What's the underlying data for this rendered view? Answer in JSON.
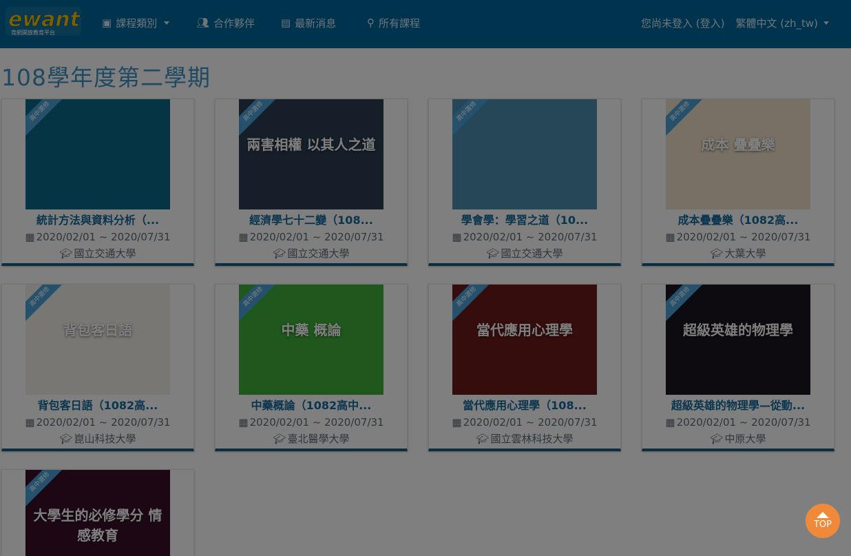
{
  "nav": {
    "logo_text": "ewant",
    "logo_sub": "育網開放教育平台",
    "items": [
      {
        "label": "課程類別",
        "icon": "archive-icon"
      },
      {
        "label": "合作夥伴",
        "icon": "users-icon"
      },
      {
        "label": "最新消息",
        "icon": "newspaper-icon"
      },
      {
        "label": "所有課程",
        "icon": "search-icon"
      }
    ],
    "login_text": "您尚未登入 (登入)",
    "language": "繁體中文 (zh_tw)"
  },
  "page": {
    "title": "108學年度第二學期"
  },
  "ribbon_label": "高中選修",
  "courses": [
    {
      "title": "統計方法與資料分析（...",
      "date": "2020/02/01 ~ 2020/07/31",
      "school": "國立交通大學",
      "theme": "#0a6b8a"
    },
    {
      "title": "經濟學七十二變（108...",
      "date": "2020/02/01 ~ 2020/07/31",
      "school": "國立交通大學",
      "theme": "#2b3d52",
      "overlay": "兩害相權 以其人之道"
    },
    {
      "title": "學會學：學習之道（10...",
      "date": "2020/02/01 ~ 2020/07/31",
      "school": "國立交通大學",
      "theme": "#4d8fb0"
    },
    {
      "title": "成本疊疊樂（1082高...",
      "date": "2020/02/01 ~ 2020/07/31",
      "school": "大葉大學",
      "theme": "#f0e0c8",
      "overlay": "成本 疊疊樂"
    },
    {
      "title": "背包客日語（1082高...",
      "date": "2020/02/01 ~ 2020/07/31",
      "school": "崑山科技大學",
      "theme": "#f2efe8",
      "overlay": "背包客日語"
    },
    {
      "title": "中藥概論（1082高中...",
      "date": "2020/02/01 ~ 2020/07/31",
      "school": "臺北醫學大學",
      "theme": "#3fae3a",
      "overlay": "中藥 概論"
    },
    {
      "title": "當代應用心理學（108...",
      "date": "2020/02/01 ~ 2020/07/31",
      "school": "國立雲林科技大學",
      "theme": "#6b1a1a",
      "overlay": "當代應用心理學"
    },
    {
      "title": "超級英雄的物理學—從動...",
      "date": "2020/02/01 ~ 2020/07/31",
      "school": "中原大學",
      "theme": "#1a1620",
      "overlay": "超級英雄的物理學"
    },
    {
      "title": "",
      "date": "",
      "school": "",
      "theme": "#3a0f2a",
      "overlay": "大學生的必修學分 情感教育"
    }
  ],
  "top_button": "TOP"
}
